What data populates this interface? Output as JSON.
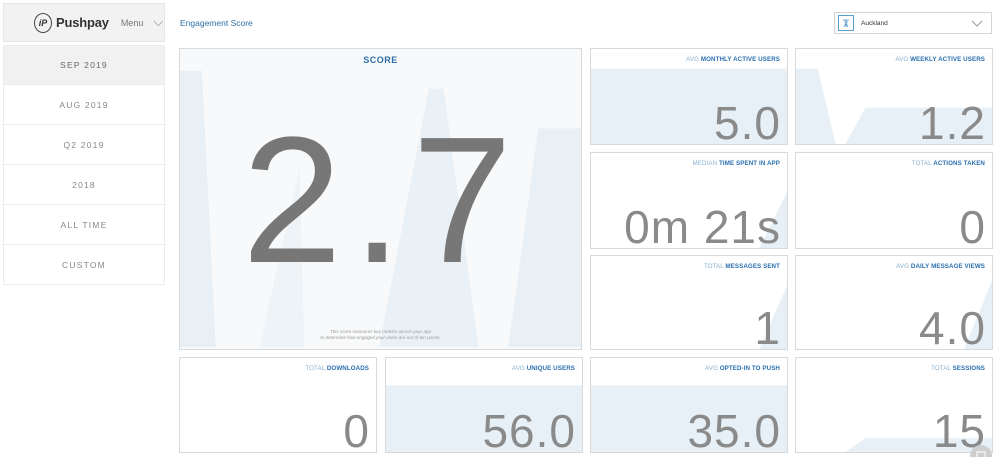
{
  "brand": {
    "name": "Pushpay",
    "logo_text": "iP",
    "menu_label": "Menu"
  },
  "sidebar": {
    "periods": [
      {
        "label": "SEP 2019",
        "active": true
      },
      {
        "label": "AUG 2019",
        "active": false
      },
      {
        "label": "Q2 2019",
        "active": false
      },
      {
        "label": "2018",
        "active": false
      },
      {
        "label": "ALL TIME",
        "active": false
      },
      {
        "label": "CUSTOM",
        "active": false
      }
    ]
  },
  "header": {
    "title": "Engagement Score",
    "location": "Auckland"
  },
  "score": {
    "title": "SCORE",
    "value": "2.7",
    "note_line1": "This score measures key metrics across your app",
    "note_line2": "to determine how engaged your users are out of ten points."
  },
  "metrics": {
    "mau": {
      "prefix": "AVG",
      "label": "MONTHLY ACTIVE USERS",
      "value": "5.0"
    },
    "wau": {
      "prefix": "AVG",
      "label": "WEEKLY ACTIVE USERS",
      "value": "1.2"
    },
    "time": {
      "prefix": "MEDIAN",
      "label": "TIME SPENT IN APP",
      "value": "0m 21s"
    },
    "actions": {
      "prefix": "TOTAL",
      "label": "ACTIONS TAKEN",
      "value": "0"
    },
    "messages": {
      "prefix": "TOTAL",
      "label": "MESSAGES SENT",
      "value": "1"
    },
    "views": {
      "prefix": "AVG",
      "label": "DAILY MESSAGE VIEWS",
      "value": "4.0"
    },
    "downloads": {
      "prefix": "TOTAL",
      "label": "DOWNLOADS",
      "value": "0"
    },
    "unique": {
      "prefix": "AVG",
      "label": "UNIQUE USERS",
      "value": "56.0"
    },
    "push": {
      "prefix": "AVG",
      "label": "OPTED-IN TO PUSH",
      "value": "35.0"
    },
    "sessions": {
      "prefix": "TOTAL",
      "label": "SESSIONS",
      "value": "15"
    }
  },
  "colors": {
    "accent": "#2e6fa8",
    "chart_fill": "#e6f0f6",
    "tile_border": "#d9d9d9"
  },
  "icons": {
    "logo": "pushpay-logo-icon",
    "chevron": "chevron-down-icon",
    "location": "location-tower-icon",
    "chat": "chat-icon"
  }
}
